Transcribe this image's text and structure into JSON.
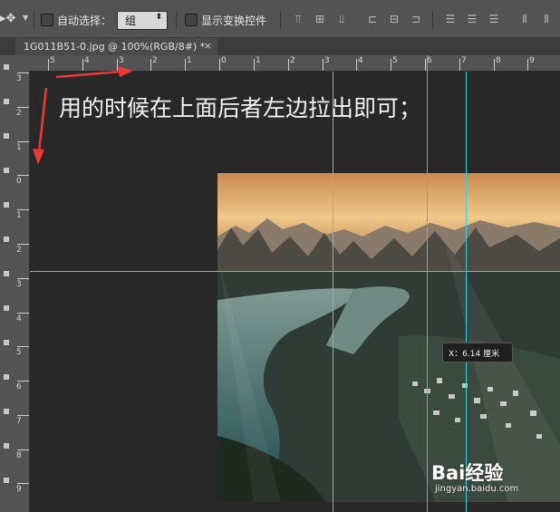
{
  "options_bar": {
    "auto_select_label": "自动选择：",
    "auto_select_value": "组",
    "show_transform_label": "显示变换控件"
  },
  "document_tab": {
    "title": "1G011B51-0.jpg @ 100%(RGB/8#) *",
    "close": "×"
  },
  "horizontal_ruler": {
    "labels": [
      "5",
      "4",
      "3",
      "2",
      "1",
      "0",
      "1",
      "2",
      "3",
      "4",
      "5",
      "6",
      "7",
      "8",
      "9"
    ]
  },
  "vertical_ruler": {
    "labels": [
      "3",
      "2",
      "1",
      "0",
      "1",
      "2",
      "3",
      "4",
      "5",
      "6",
      "7",
      "8",
      "9"
    ]
  },
  "canvas": {
    "instruction": "用的时候在上面后者左边拉出即可；",
    "tooltip": "X：6.14 厘米"
  },
  "watermark": {
    "logo": "Bai经验",
    "site": "jingyan.baidu.com"
  },
  "colors": {
    "guide": "#40d0dc",
    "arrow": "#e83a36",
    "canvas_bg": "#282828",
    "panel": "#535353"
  }
}
